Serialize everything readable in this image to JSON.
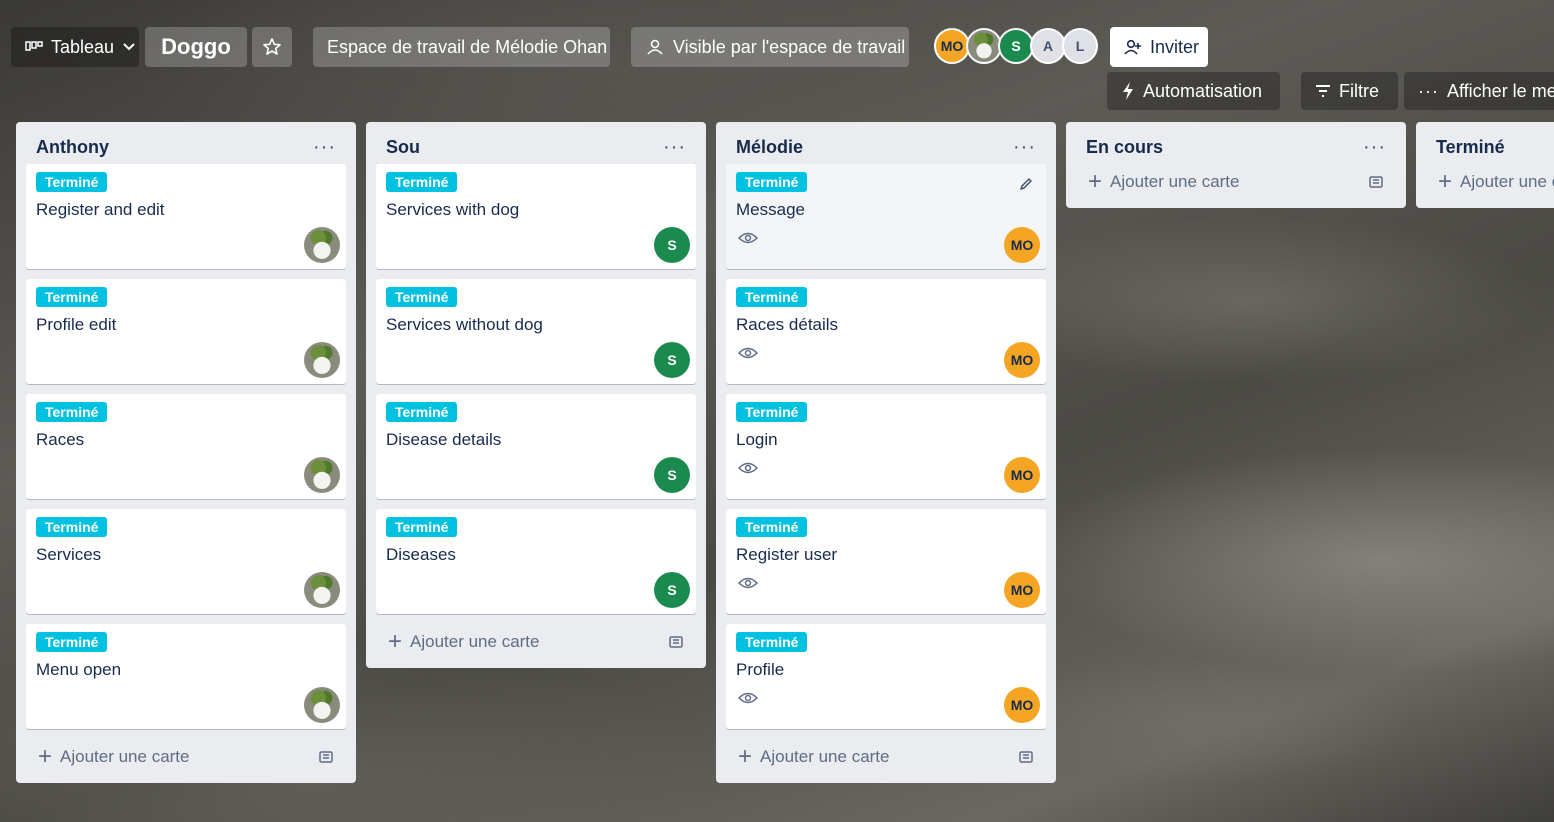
{
  "topbar": {
    "board_view": "Tableau",
    "board_name": "Doggo",
    "workspace": "Espace de travail de Mélodie Ohan",
    "visibility": "Visible par l'espace de travail",
    "invite": "Inviter",
    "automation": "Automatisation",
    "filter": "Filtre",
    "show_menu": "Afficher le menu"
  },
  "members": [
    {
      "initials": "MO",
      "kind": "mo"
    },
    {
      "initials": "",
      "kind": "img"
    },
    {
      "initials": "S",
      "kind": "s"
    },
    {
      "initials": "A",
      "kind": "grey"
    },
    {
      "initials": "L",
      "kind": "grey"
    }
  ],
  "add_card": "Ajouter une carte",
  "label_done": "Terminé",
  "lists": [
    {
      "title": "Anthony",
      "cards": [
        {
          "title": "Register and edit",
          "member": "img"
        },
        {
          "title": "Profile edit",
          "member": "img"
        },
        {
          "title": "Races",
          "member": "img"
        },
        {
          "title": "Services",
          "member": "img"
        },
        {
          "title": "Menu open",
          "member": "img"
        }
      ]
    },
    {
      "title": "Sou",
      "cards": [
        {
          "title": "Services with dog",
          "member": "S"
        },
        {
          "title": "Services without dog",
          "member": "S"
        },
        {
          "title": "Disease details",
          "member": "S"
        },
        {
          "title": "Diseases",
          "member": "S"
        }
      ]
    },
    {
      "title": "Mélodie",
      "cards": [
        {
          "title": "Message",
          "member": "MO"
        },
        {
          "title": "Races détails",
          "member": "MO"
        },
        {
          "title": "Login",
          "member": "MO"
        },
        {
          "title": "Register user",
          "member": "MO"
        },
        {
          "title": "Profile",
          "member": "MO"
        }
      ]
    },
    {
      "title": "En cours",
      "cards": []
    },
    {
      "title": "Terminé",
      "cards": []
    }
  ],
  "colors": {
    "label": "#00c2e0",
    "list_bg": "#ebecf0",
    "mo": "#f5a524",
    "s": "#1b8a4f"
  }
}
